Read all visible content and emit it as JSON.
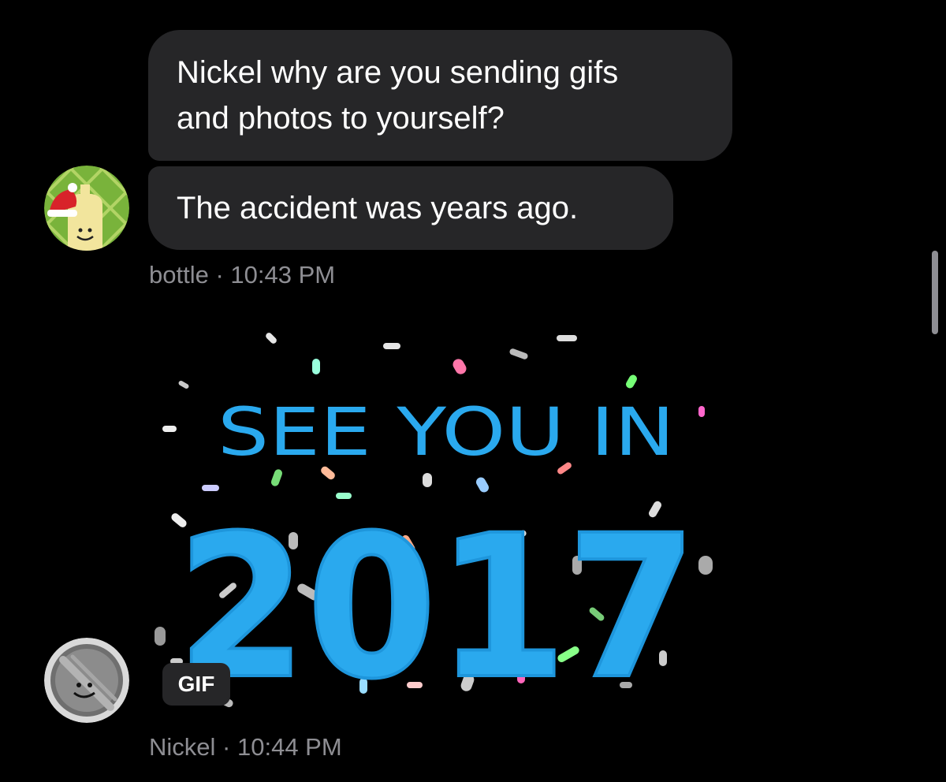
{
  "messages": [
    {
      "text_line_1": "Nickel why are you sending gifs",
      "text_line_2": "and photos to yourself?"
    },
    {
      "text": "The accident was years ago."
    }
  ],
  "bottle_meta": {
    "sender": "bottle",
    "separator": "·",
    "time": "10:43 PM"
  },
  "gif": {
    "line_1": "SEE YOU IN",
    "line_2": "2017",
    "badge": "GIF"
  },
  "nickel_meta": {
    "sender": "Nickel",
    "separator": "·",
    "time": "10:44 PM"
  },
  "colors": {
    "background": "#000000",
    "bubble": "#262628",
    "meta_text": "#8e8e93",
    "gif_text": "#2aa9ee"
  },
  "icons": [
    "bottle-avatar-icon",
    "nickel-avatar-icon"
  ]
}
